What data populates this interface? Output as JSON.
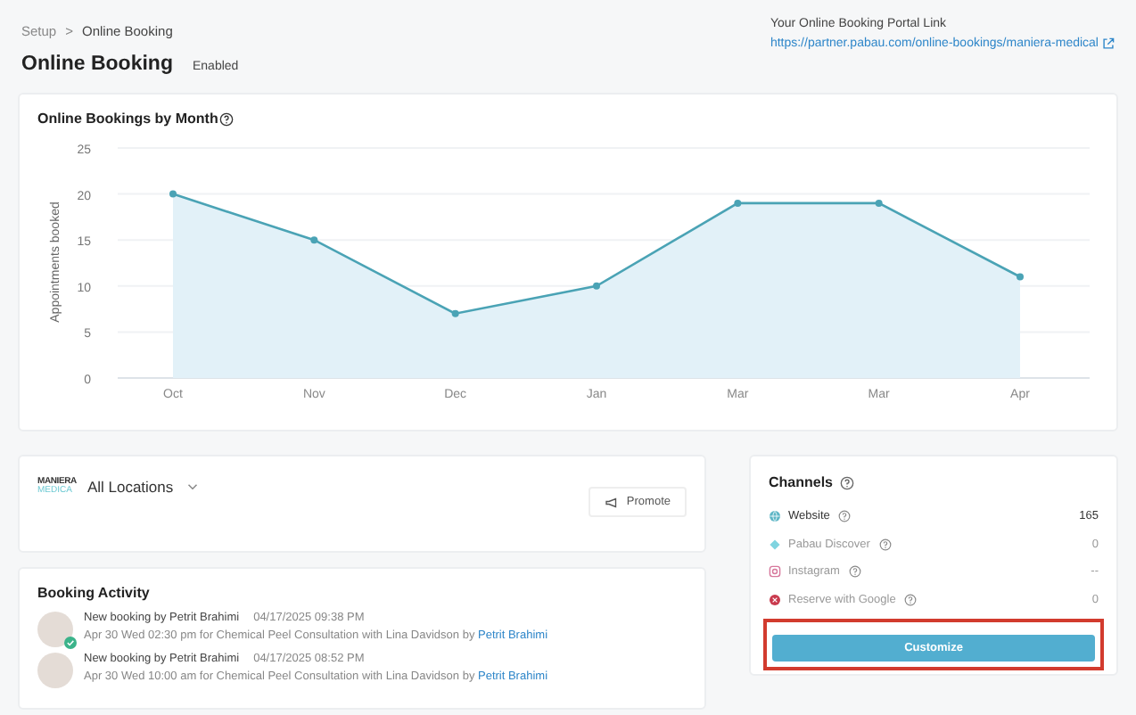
{
  "breadcrumb": [
    {
      "label": "Setup",
      "current": false
    },
    {
      "label": "Online Booking",
      "current": true
    }
  ],
  "breadcrumb_separator": ">",
  "page": {
    "title": "Online Booking",
    "status": "Enabled"
  },
  "portal_link": {
    "label": "Your Online Booking Portal Link",
    "url": "https://partner.pabau.com/online-bookings/maniera-medical"
  },
  "chart_card": {
    "title": "Online Bookings by Month",
    "chart_data": {
      "type": "area",
      "ylabel": "Appointments booked",
      "categories": [
        "Oct",
        "Nov",
        "Dec",
        "Jan",
        "Mar",
        "Mar",
        "Apr"
      ],
      "series": [
        {
          "color": "#4aa3b5",
          "values": [
            20,
            15,
            7,
            10,
            19,
            19,
            11
          ]
        }
      ],
      "grid": true,
      "ylim": [
        0,
        25
      ],
      "yticks": [
        0,
        5,
        10,
        15,
        20,
        25
      ]
    }
  },
  "locations": {
    "logo_top": "MANIERA",
    "logo_bottom": "MEDICA",
    "label": "All Locations",
    "promote_button": "Promote"
  },
  "booking_activity": {
    "title": "Booking Activity",
    "items": [
      {
        "title": "New booking by Petrit Brahimi",
        "time": "04/17/2025 09:38 PM",
        "text": "Apr 30 Wed 02:30 pm for Chemical Peel Consultation with Lina Davidson by",
        "author": "Petrit Brahimi",
        "verified": true
      },
      {
        "title": "New booking by Petrit Brahimi",
        "time": "04/17/2025 08:52 PM",
        "text": "Apr 30 Wed 10:00 am for Chemical Peel Consultation with Lina Davidson by",
        "author": "Petrit Brahimi",
        "verified": false
      }
    ]
  },
  "channels": {
    "title": "Channels",
    "items": [
      {
        "kind": "website",
        "name": "Website",
        "count": "165",
        "active": true
      },
      {
        "kind": "discover",
        "name": "Pabau Discover",
        "count": "0",
        "active": false
      },
      {
        "kind": "instagram",
        "name": "Instagram",
        "count": "--",
        "active": false
      },
      {
        "kind": "google",
        "name": "Reserve with Google",
        "count": "0",
        "active": false
      }
    ],
    "button": {
      "label": "Customize",
      "highlighted": true
    }
  }
}
